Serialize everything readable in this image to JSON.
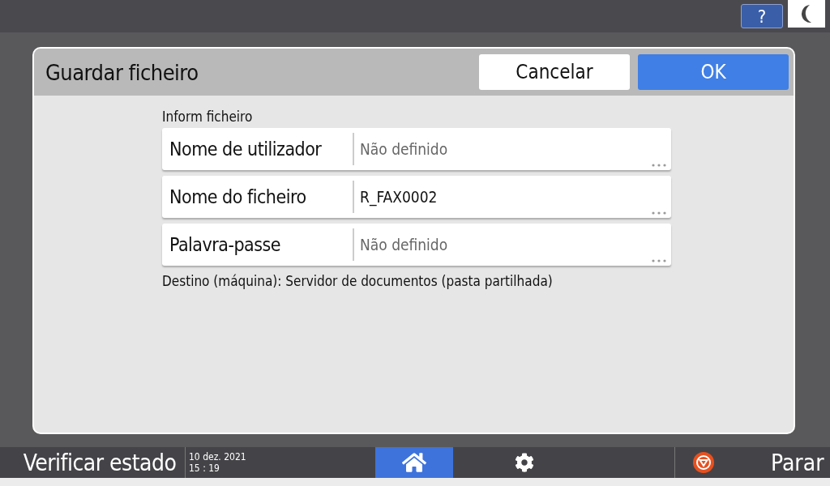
{
  "top_bar": {
    "help_label": "?"
  },
  "dialog": {
    "title": "Guardar ficheiro",
    "buttons": [
      {
        "label": "Cancelar",
        "kind": "secondary"
      },
      {
        "label": "OK",
        "kind": "primary"
      }
    ],
    "section_label": "Inform ficheiro",
    "fields": [
      {
        "label": "Nome de utilizador",
        "placeholder": "Não definido"
      },
      {
        "label": "Nome do ficheiro",
        "value": "R_FAX0002"
      },
      {
        "label": "Palavra-passe",
        "placeholder": "Não definido"
      }
    ],
    "destination": "Destino (máquina): Servidor de documentos (pasta partilhada)"
  },
  "bottom_bar": {
    "status_label": "Verificar estado",
    "date": "10 dez. 2021",
    "time": "15 : 19",
    "tabs": [
      {
        "kind": "home",
        "selected": true
      },
      {
        "kind": "settings",
        "selected": false
      }
    ],
    "stop_label": "Parar"
  }
}
